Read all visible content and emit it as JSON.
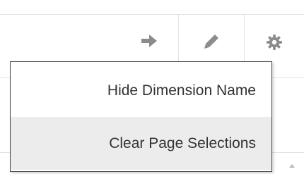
{
  "toolbar": {
    "icons": [
      "arrow-right-icon",
      "pencil-icon",
      "gear-icon"
    ],
    "icon_color": "#8c8c8c",
    "divider_color": "#e3e3e3"
  },
  "menu": {
    "items": [
      {
        "label": "Hide Dimension Name",
        "highlighted": false
      },
      {
        "label": "Clear Page Selections",
        "highlighted": true
      }
    ],
    "border_color": "#4a4a4a",
    "highlight_color": "#ececec",
    "text_color": "#333333"
  },
  "scroll": {
    "icon": "scroll-up-arrow-icon"
  }
}
